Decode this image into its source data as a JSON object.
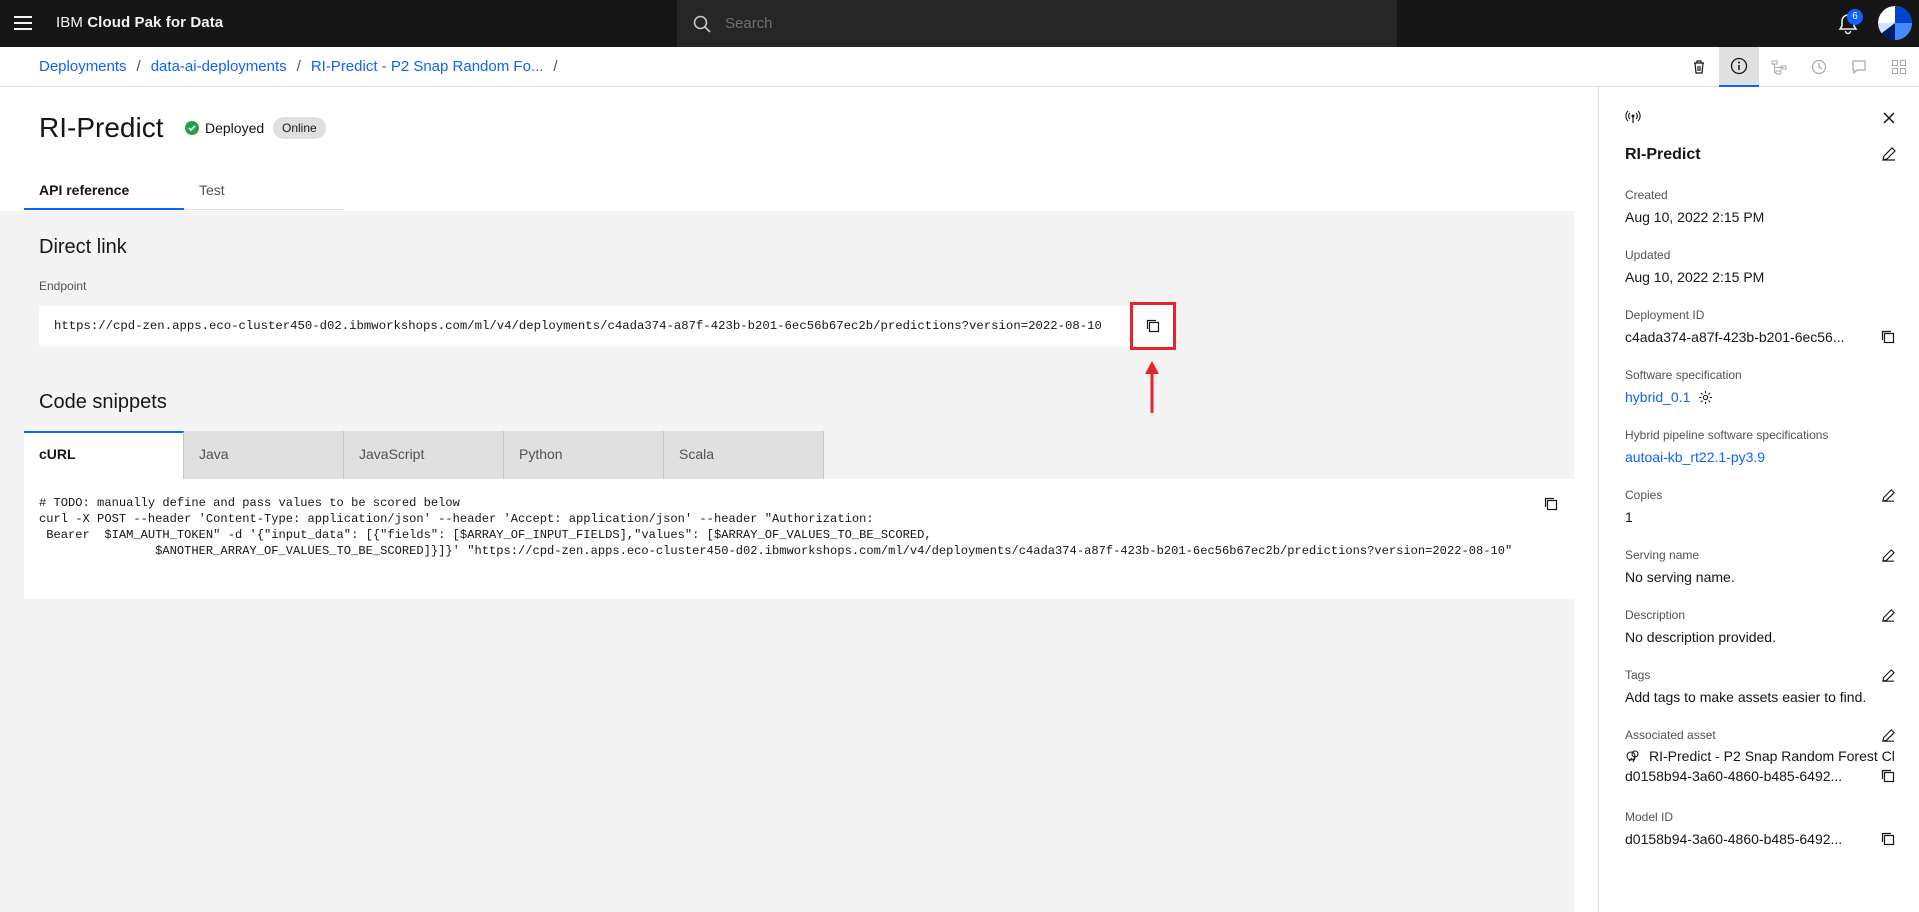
{
  "header": {
    "brand_prefix": "IBM",
    "brand_name": "Cloud Pak for Data",
    "search_placeholder": "Search",
    "notification_count": "6"
  },
  "breadcrumb": {
    "items": [
      "Deployments",
      "data-ai-deployments",
      "RI-Predict - P2 Snap Random Fo..."
    ],
    "separator": "/"
  },
  "toolbar": {
    "icons": [
      "trash-icon",
      "info-icon",
      "pipeline-icon",
      "history-icon",
      "comment-icon",
      "apps-icon"
    ],
    "active": "info-icon"
  },
  "page": {
    "title": "RI-Predict",
    "status": "Deployed",
    "tag": "Online",
    "tabs": [
      "API reference",
      "Test"
    ],
    "active_tab": "API reference"
  },
  "direct_link": {
    "title": "Direct link",
    "endpoint_label": "Endpoint",
    "endpoint_url": "https://cpd-zen.apps.eco-cluster450-d02.ibmworkshops.com/ml/v4/deployments/c4ada374-a87f-423b-b201-6ec56b67ec2b/predictions?version=2022-08-10"
  },
  "code_snippets": {
    "title": "Code snippets",
    "tabs": [
      "cURL",
      "Java",
      "JavaScript",
      "Python",
      "Scala"
    ],
    "active_tab": "cURL",
    "code": "# TODO: manually define and pass values to be scored below\ncurl -X POST --header 'Content-Type: application/json' --header 'Accept: application/json' --header \"Authorization:\n Bearer  $IAM_AUTH_TOKEN\" -d '{\"input_data\": [{\"fields\": [$ARRAY_OF_INPUT_FIELDS],\"values\": [$ARRAY_OF_VALUES_TO_BE_SCORED,\n                $ANOTHER_ARRAY_OF_VALUES_TO_BE_SCORED]}]}' \"https://cpd-zen.apps.eco-cluster450-d02.ibmworkshops.com/ml/v4/deployments/c4ada374-a87f-423b-b201-6ec56b67ec2b/predictions?version=2022-08-10\""
  },
  "panel": {
    "title": "RI-Predict",
    "created_label": "Created",
    "created_value": "Aug 10, 2022 2:15 PM",
    "updated_label": "Updated",
    "updated_value": "Aug 10, 2022 2:15 PM",
    "deployment_id_label": "Deployment ID",
    "deployment_id_value": "c4ada374-a87f-423b-b201-6ec56...",
    "software_spec_label": "Software specification",
    "software_spec_value": "hybrid_0.1",
    "hybrid_pipeline_label": "Hybrid pipeline software specifications",
    "hybrid_pipeline_value": "autoai-kb_rt22.1-py3.9",
    "copies_label": "Copies",
    "copies_value": "1",
    "serving_name_label": "Serving name",
    "serving_name_value": "No serving name.",
    "description_label": "Description",
    "description_value": "No description provided.",
    "tags_label": "Tags",
    "tags_value": "Add tags to make assets easier to find.",
    "associated_asset_label": "Associated asset",
    "associated_asset_name": "RI-Predict - P2 Snap Random Forest Cl",
    "associated_asset_id": "d0158b94-3a60-4860-b485-6492...",
    "model_id_label": "Model ID",
    "model_id_value": "d0158b94-3a60-4860-b485-6492..."
  },
  "colors": {
    "accent": "#0f62fe",
    "success": "#24a148",
    "highlight": "#e8232b",
    "header_bg": "#161616"
  }
}
